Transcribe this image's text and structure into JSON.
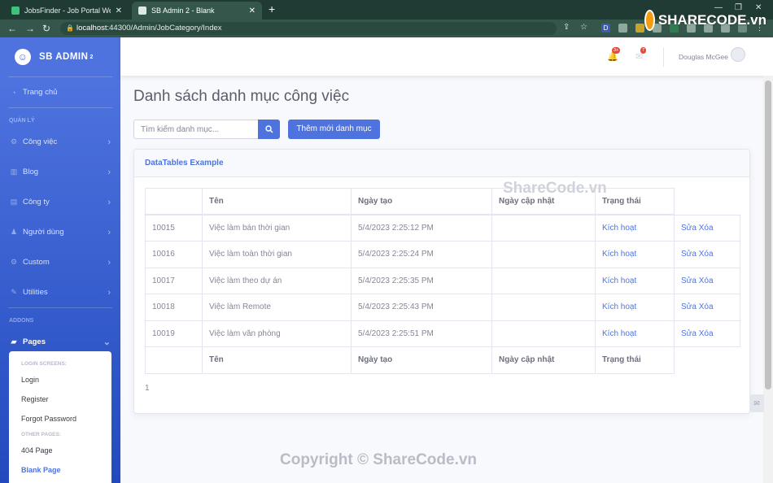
{
  "browser": {
    "tabs": [
      {
        "title": "JobsFinder - Job Portal Website T",
        "close": "✕"
      },
      {
        "title": "SB Admin 2 - Blank",
        "close": "✕"
      }
    ],
    "new_tab": "+",
    "url_host": "localhost",
    "url_rest": ":44300/Admin/JobCategory/Index",
    "extensions": [
      "D",
      "",
      "",
      "",
      "",
      "",
      "",
      "",
      "",
      ""
    ]
  },
  "sidebar": {
    "brand": "SB ADMIN",
    "brand_sup": "2",
    "dashboard": "Trang chủ",
    "heading_manage": "QUẢN LÝ",
    "items": [
      {
        "label": "Công việc"
      },
      {
        "label": "Blog"
      },
      {
        "label": "Công ty"
      },
      {
        "label": "Người dùng"
      },
      {
        "label": "Custom"
      },
      {
        "label": "Utilities"
      }
    ],
    "heading_addons": "ADDONS",
    "pages": "Pages",
    "submenu": {
      "heading_login": "LOGIN SCREENS:",
      "login": "Login",
      "register": "Register",
      "forgot": "Forgot Password",
      "heading_other": "OTHER PAGES:",
      "p404": "404 Page",
      "blank": "Blank Page"
    }
  },
  "topbar": {
    "alerts_badge": "3+",
    "messages_badge": "7",
    "user_name": "Douglas McGee"
  },
  "main": {
    "title": "Danh sách danh mục công việc",
    "search_placeholder": "Tìm kiếm danh mục...",
    "add_button": "Thêm mới danh mục",
    "card_title": "DataTables Example",
    "columns": [
      "",
      "Tên",
      "Ngày tạo",
      "Ngày cập nhật",
      "Trạng thái"
    ],
    "rows": [
      {
        "id": "10015",
        "name": "Việc làm bán thời gian",
        "created": "5/4/2023 2:25:12 PM",
        "updated": "",
        "status": "Kích hoạt",
        "edit": "Sửa",
        "delete": "Xóa"
      },
      {
        "id": "10016",
        "name": "Việc làm toàn thời gian",
        "created": "5/4/2023 2:25:24 PM",
        "updated": "",
        "status": "Kích hoạt",
        "edit": "Sửa",
        "delete": "Xóa"
      },
      {
        "id": "10017",
        "name": "Việc làm theo dự án",
        "created": "5/4/2023 2:25:35 PM",
        "updated": "",
        "status": "Kích hoạt",
        "edit": "Sửa",
        "delete": "Xóa"
      },
      {
        "id": "10018",
        "name": "Việc làm Remote",
        "created": "5/4/2023 2:25:43 PM",
        "updated": "",
        "status": "Kích hoạt",
        "edit": "Sửa",
        "delete": "Xóa"
      },
      {
        "id": "10019",
        "name": "Việc làm văn phòng",
        "created": "5/4/2023 2:25:51 PM",
        "updated": "",
        "status": "Kích hoạt",
        "edit": "Sửa",
        "delete": "Xóa"
      }
    ],
    "page": "1"
  },
  "watermarks": {
    "logo": "SHARECODE.vn",
    "mid": "ShareCode.vn",
    "bottom": "Copyright © ShareCode.vn"
  }
}
